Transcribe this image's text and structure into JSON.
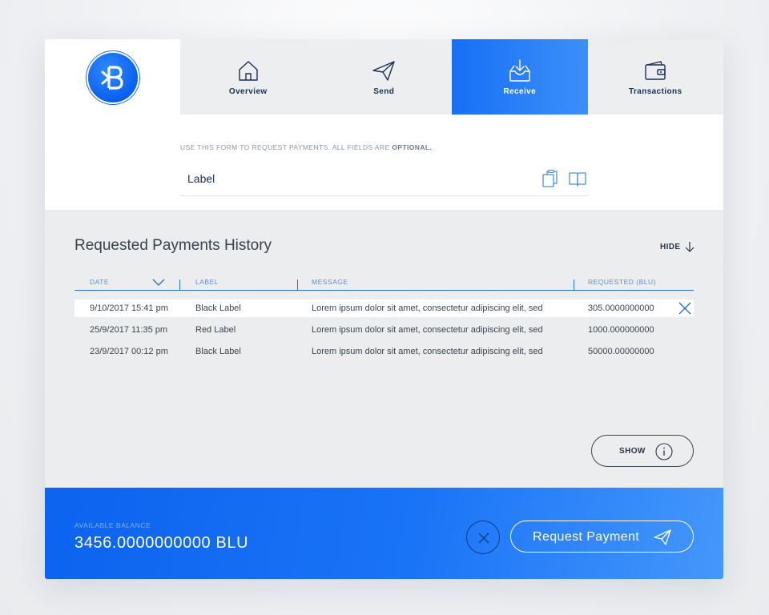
{
  "colors": {
    "accent": "#1670f5",
    "text_dark": "#1b2f4f",
    "header_text": "#5d8fd6"
  },
  "nav": {
    "logo_icon": "blu-logo-icon",
    "tabs": [
      {
        "label": "Overview",
        "icon": "home-icon"
      },
      {
        "label": "Send",
        "icon": "paper-plane-icon"
      },
      {
        "label": "Receive",
        "icon": "inbox-download-icon",
        "active": true
      },
      {
        "label": "Transactions",
        "icon": "wallet-icon"
      }
    ]
  },
  "form": {
    "hint_prefix": "USE THIS FORM TO REQUEST PAYMENTS. ALL FIELDS ARE ",
    "hint_bold": "OPTIONAL.",
    "label_field": "Label"
  },
  "history": {
    "title": "Requested Payments History",
    "hide_label": "HIDE",
    "columns": [
      "DATE",
      "LABEL",
      "MESSAGE",
      "REQUESTED (BLU)"
    ],
    "rows": [
      {
        "date": "9/10/2017 15:41 pm",
        "label": "Black Label",
        "message": "Lorem ipsum dolor sit amet, consectetur adipiscing elit, sed",
        "amount": "305.0000000000"
      },
      {
        "date": "25/9/2017 11:35 pm",
        "label": "Red Label",
        "message": "Lorem ipsum dolor sit amet, consectetur adipiscing elit, sed",
        "amount": "1000.000000000"
      },
      {
        "date": "23/9/2017 00:12 pm",
        "label": "Black Label",
        "message": "Lorem ipsum dolor sit amet, consectetur adipiscing elit, sed",
        "amount": "50000.00000000"
      }
    ],
    "show_label": "SHOW"
  },
  "footer": {
    "balance_label": "AVAILABLE BALANCE",
    "balance_value": "3456.0000000000 BLU",
    "request_label": "Request Payment"
  }
}
